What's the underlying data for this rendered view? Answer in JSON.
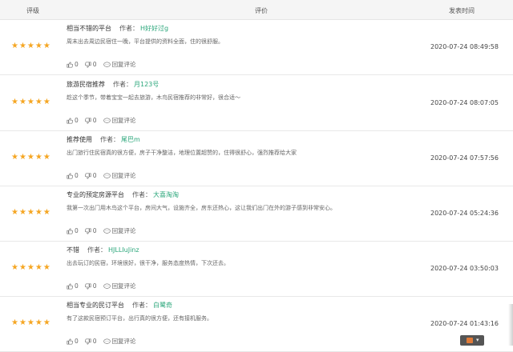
{
  "header": {
    "rating": "评级",
    "review": "评价",
    "time": "发表时间"
  },
  "labels": {
    "author": "作者：",
    "reply": "回复评论"
  },
  "colors": {
    "star": "#f5a623",
    "author": "#2aa67a"
  },
  "reviews": [
    {
      "stars": "★★★★★",
      "title": "相当不错的平台",
      "author": "H好好过g",
      "desc": "周末出去周边民宿住一晚，平台提供的资料全面，住的很舒服。",
      "likes": "0",
      "dislikes": "0",
      "time": "2020-07-24 08:49:58"
    },
    {
      "stars": "★★★★★",
      "title": "旅游民宿推荐",
      "author": "月123号",
      "desc": "趁这个季节，带着宝宝一起去旅游，木鸟民宿推荐的非常好，很合适～",
      "likes": "0",
      "dislikes": "0",
      "time": "2020-07-24 08:07:05"
    },
    {
      "stars": "★★★★★",
      "title": "推荐使用",
      "author": "尾巴m",
      "desc": "出门旅行住民宿真的很方便，房子干净整洁，地理位置超赞的，住得很舒心，强烈推荐给大家",
      "likes": "0",
      "dislikes": "0",
      "time": "2020-07-24 07:57:56"
    },
    {
      "stars": "★★★★★",
      "title": "专业的预定房源平台",
      "author": "大喜淘淘",
      "desc": "我第一次出门用木鸟这个平台，房间大气，设施齐全，房东还热心，这让我们出门在外的游子感到非常安心。",
      "likes": "0",
      "dislikes": "0",
      "time": "2020-07-24 05:24:36"
    },
    {
      "stars": "★★★★★",
      "title": "不错",
      "author": "HJLLIuJinz",
      "desc": "出去玩订的民宿，环境很好，很干净，服务态度热情，下次还去。",
      "likes": "0",
      "dislikes": "0",
      "time": "2020-07-24 03:50:03"
    },
    {
      "stars": "★★★★★",
      "title": "相当专业的民订平台",
      "author": "白鹭奇",
      "desc": "有了这款民宿预订平台，出行真的很方便，还有接机服务。",
      "likes": "0",
      "dislikes": "0",
      "time": "2020-07-24 01:43:16"
    }
  ]
}
